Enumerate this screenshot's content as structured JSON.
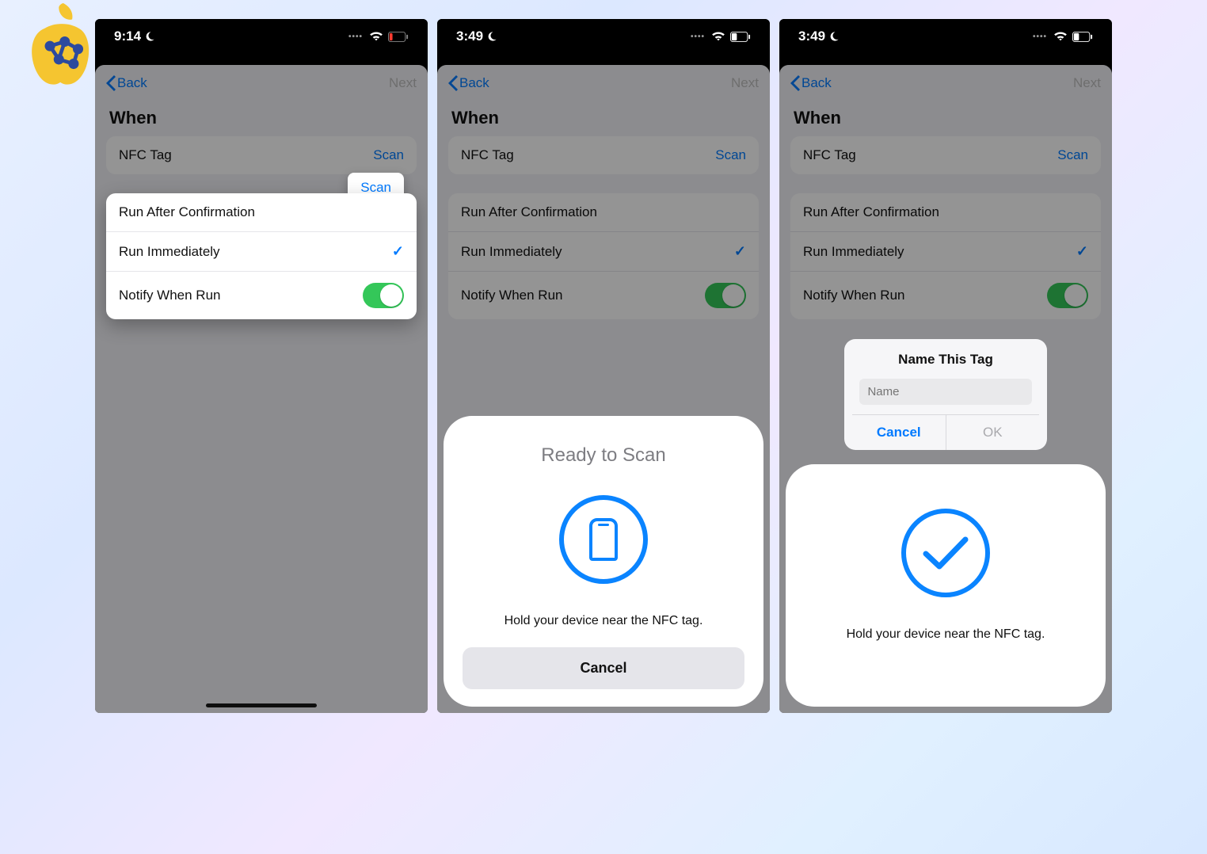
{
  "colors": {
    "accent": "#007aff",
    "toggle_on": "#34c759",
    "dim": "rgba(0,0,0,0.42)"
  },
  "status": {
    "time_phone1": "9:14",
    "time_phone2": "3:49",
    "time_phone3": "3:49"
  },
  "nav": {
    "back_label": "Back",
    "next_label": "Next"
  },
  "section": {
    "title": "When"
  },
  "nfc_row": {
    "label": "NFC Tag",
    "scan_label": "Scan"
  },
  "options": {
    "run_after_confirmation": "Run After Confirmation",
    "run_immediately": "Run Immediately",
    "notify_when_run": "Notify When Run",
    "run_immediately_selected": true,
    "notify_toggle_on": true
  },
  "scan_sheet": {
    "title": "Ready to Scan",
    "message": "Hold your device near the NFC tag.",
    "cancel_label": "Cancel"
  },
  "name_alert": {
    "title": "Name This Tag",
    "placeholder": "Name",
    "cancel_label": "Cancel",
    "ok_label": "OK"
  }
}
